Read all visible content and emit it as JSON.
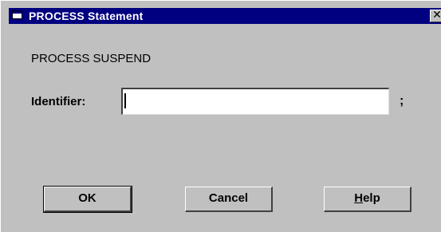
{
  "window": {
    "title": "PROCESS Statement",
    "close_glyph": "✕",
    "system_icon": "window-menu-icon"
  },
  "statement": "PROCESS SUSPEND",
  "identifier": {
    "label": "Identifier:",
    "value": "",
    "terminator": ";"
  },
  "buttons": {
    "ok": "OK",
    "cancel": "Cancel",
    "help_first": "H",
    "help_rest": "elp"
  },
  "colors": {
    "titlebar": "#000080",
    "face": "#c0c0c0"
  }
}
